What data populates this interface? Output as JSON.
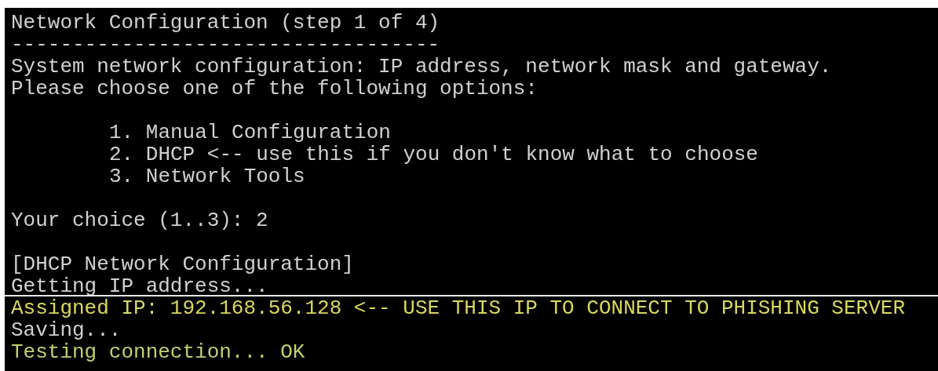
{
  "terminal": {
    "lines": [
      {
        "kind": "plain",
        "text": "Network Configuration (step 1 of 4)",
        "color": "#d0d0d0"
      },
      {
        "kind": "plain",
        "text": "-----------------------------------",
        "color": "#d0d0d0"
      },
      {
        "kind": "plain",
        "text": "System network configuration: IP address, network mask and gateway.",
        "color": "#d0d0d0"
      },
      {
        "kind": "plain",
        "text": "Please choose one of the following options:",
        "color": "#d0d0d0"
      },
      {
        "kind": "blank"
      },
      {
        "kind": "option",
        "text": "1. Manual Configuration",
        "color": "#d0d0d0"
      },
      {
        "kind": "option",
        "text": "2. DHCP <-- use this if you don't know what to choose",
        "color": "#d0d0d0"
      },
      {
        "kind": "option",
        "text": "3. Network Tools",
        "color": "#d0d0d0"
      },
      {
        "kind": "blank"
      },
      {
        "kind": "plain",
        "text": "Your choice (1..3): 2",
        "color": "#d0d0d0"
      },
      {
        "kind": "blank"
      },
      {
        "kind": "plain",
        "text": "[DHCP Network Configuration]",
        "color": "#d0d0d0"
      },
      {
        "kind": "plain",
        "text": "Getting IP address...",
        "color": "#d0d0d0"
      },
      {
        "kind": "rule"
      },
      {
        "kind": "plain",
        "text": "Assigned IP: 192.168.56.128 <-- USE THIS IP TO CONNECT TO PHISHING SERVER",
        "color": "#d8d860"
      },
      {
        "kind": "plain",
        "text": "Saving...",
        "color": "#d0d0d0"
      },
      {
        "kind": "plain",
        "text": "Testing connection... OK",
        "color": "#c0d070"
      }
    ]
  }
}
